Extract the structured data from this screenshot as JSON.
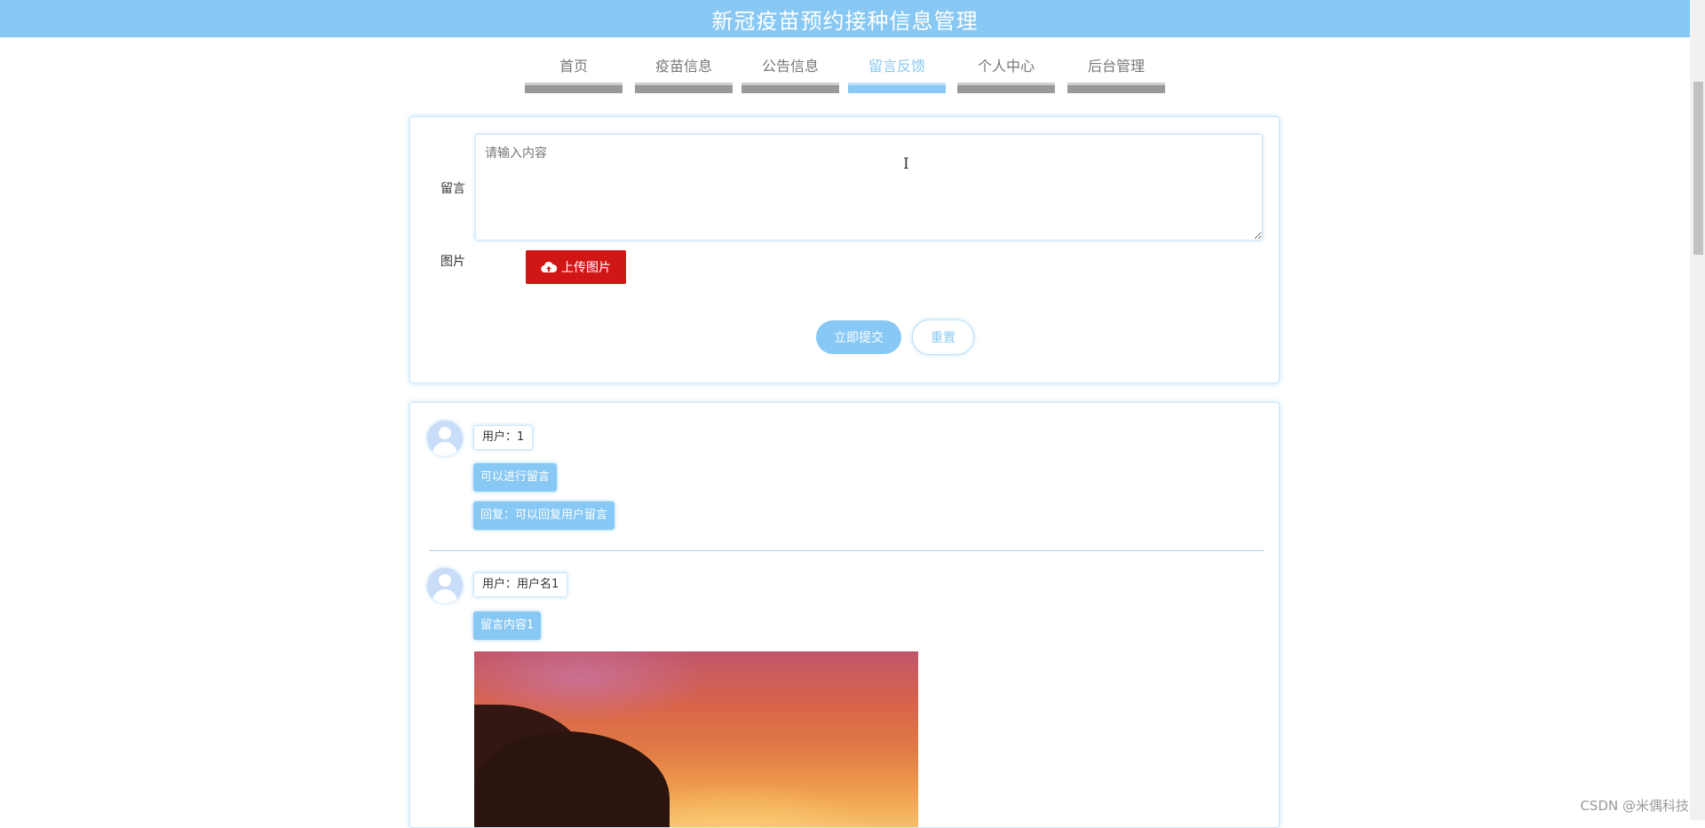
{
  "app": {
    "title": "新冠疫苗预约接种信息管理"
  },
  "nav": {
    "items": [
      {
        "label": "首页"
      },
      {
        "label": "疫苗信息"
      },
      {
        "label": "公告信息"
      },
      {
        "label": "留言反馈"
      },
      {
        "label": "个人中心"
      },
      {
        "label": "后台管理"
      }
    ],
    "active_index": 3
  },
  "form": {
    "message_label": "留言",
    "message_placeholder": "请输入内容",
    "image_label": "图片",
    "upload_label": "上传图片",
    "submit_label": "立即提交",
    "reset_label": "重置"
  },
  "messages": [
    {
      "user": "用户：1",
      "content": "可以进行留言",
      "reply": "回复：可以回复用户留言"
    },
    {
      "user": "用户：用户名1",
      "content": "留言内容1"
    }
  ],
  "colors": {
    "primary": "#88c8f4",
    "upload": "#d11616",
    "nav_inactive": "#999999"
  },
  "watermark": "CSDN @米偶科技"
}
